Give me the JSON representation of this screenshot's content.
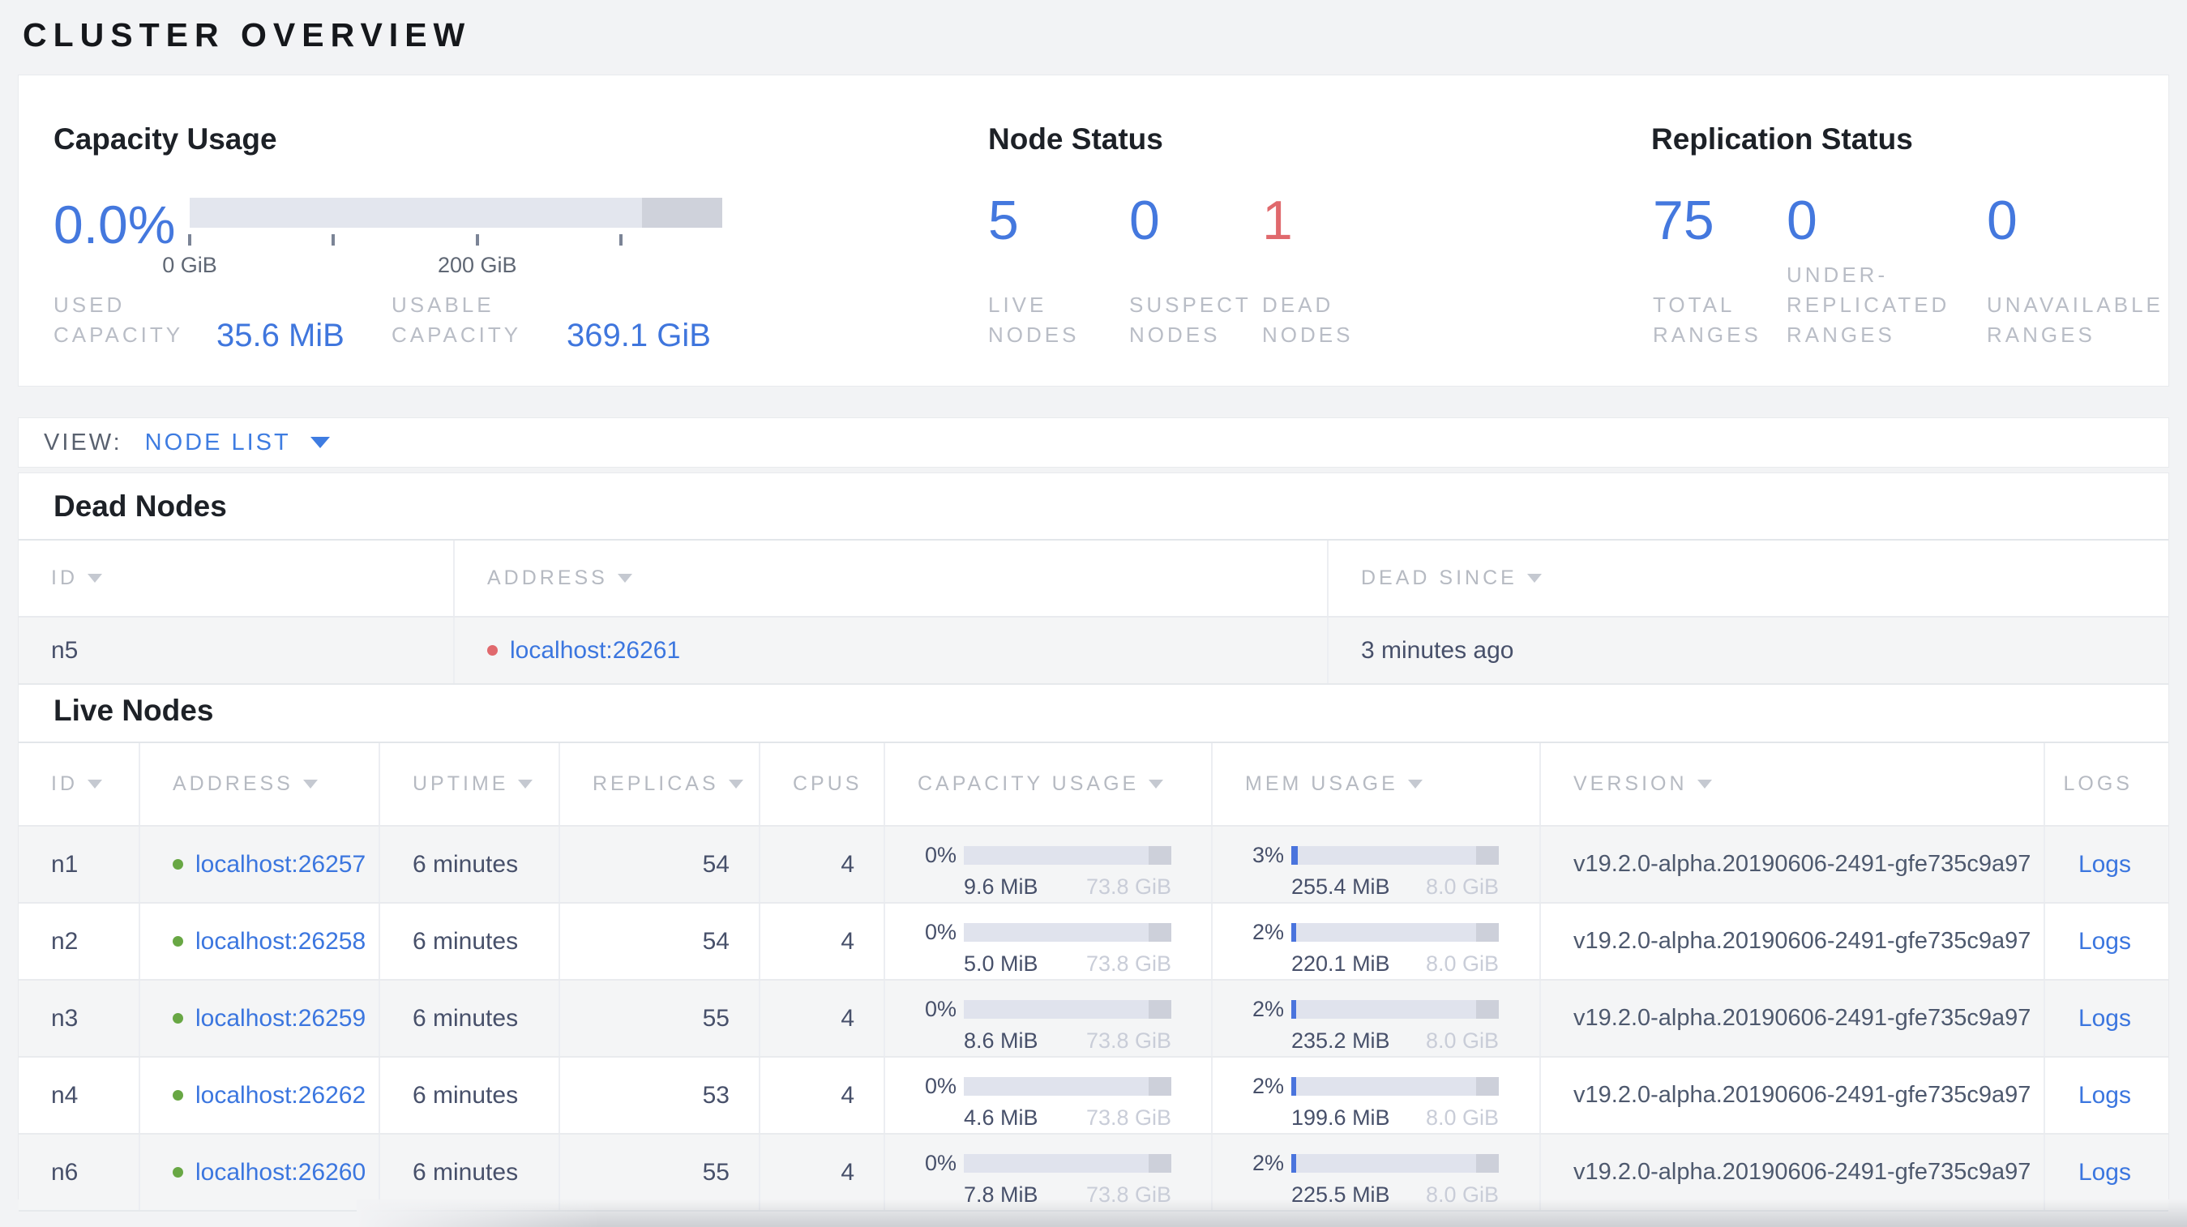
{
  "page_title": "CLUSTER OVERVIEW",
  "summary": {
    "capacity": {
      "title": "Capacity Usage",
      "percent": "0.0%",
      "bar": {
        "fill_pct": 0,
        "tick_label_0": "0 GiB",
        "tick_label_200": "200 GiB"
      },
      "stats": [
        {
          "label": "USED CAPACITY",
          "value": "35.6 MiB"
        },
        {
          "label": "USABLE CAPACITY",
          "value": "369.1 GiB"
        }
      ]
    },
    "node_status": {
      "title": "Node Status",
      "stats": [
        {
          "value": "5",
          "label": "LIVE NODES"
        },
        {
          "value": "0",
          "label": "SUSPECT NODES"
        },
        {
          "value": "1",
          "label": "DEAD NODES"
        }
      ]
    },
    "replication": {
      "title": "Replication Status",
      "stats": [
        {
          "value": "75",
          "label": "TOTAL RANGES"
        },
        {
          "value": "0",
          "label": "UNDER-REPLICATED RANGES"
        },
        {
          "value": "0",
          "label": "UNAVAILABLE RANGES"
        }
      ]
    }
  },
  "view_bar": {
    "label": "VIEW:",
    "selected": "NODE LIST"
  },
  "dead_nodes": {
    "title": "Dead Nodes",
    "columns": [
      {
        "label": "ID",
        "sortable": true
      },
      {
        "label": "ADDRESS",
        "sortable": true
      },
      {
        "label": "DEAD SINCE",
        "sortable": true
      }
    ],
    "rows": [
      {
        "id": "n5",
        "address": "localhost:26261",
        "dead_since": "3 minutes ago"
      }
    ]
  },
  "live_nodes": {
    "title": "Live Nodes",
    "columns": [
      {
        "label": "ID",
        "sortable": true
      },
      {
        "label": "ADDRESS",
        "sortable": true
      },
      {
        "label": "UPTIME",
        "sortable": true
      },
      {
        "label": "REPLICAS",
        "sortable": true
      },
      {
        "label": "CPUS",
        "sortable": false
      },
      {
        "label": "CAPACITY USAGE",
        "sortable": true
      },
      {
        "label": "MEM USAGE",
        "sortable": true
      },
      {
        "label": "VERSION",
        "sortable": true
      },
      {
        "label": "LOGS",
        "sortable": false
      }
    ],
    "rows": [
      {
        "id": "n1",
        "address": "localhost:26257",
        "uptime": "6 minutes",
        "replicas": "54",
        "cpus": "4",
        "capacity": {
          "percent": "0%",
          "used": "9.6 MiB",
          "capacity": "73.8 GiB",
          "fill_pct": 0
        },
        "memory": {
          "percent": "3%",
          "used": "255.4 MiB",
          "capacity": "8.0 GiB",
          "fill_pct": 3
        },
        "version": "v19.2.0-alpha.20190606-2491-gfe735c9a97",
        "logs_label": "Logs"
      },
      {
        "id": "n2",
        "address": "localhost:26258",
        "uptime": "6 minutes",
        "replicas": "54",
        "cpus": "4",
        "capacity": {
          "percent": "0%",
          "used": "5.0 MiB",
          "capacity": "73.8 GiB",
          "fill_pct": 0
        },
        "memory": {
          "percent": "2%",
          "used": "220.1 MiB",
          "capacity": "8.0 GiB",
          "fill_pct": 2.5
        },
        "version": "v19.2.0-alpha.20190606-2491-gfe735c9a97",
        "logs_label": "Logs"
      },
      {
        "id": "n3",
        "address": "localhost:26259",
        "uptime": "6 minutes",
        "replicas": "55",
        "cpus": "4",
        "capacity": {
          "percent": "0%",
          "used": "8.6 MiB",
          "capacity": "73.8 GiB",
          "fill_pct": 0
        },
        "memory": {
          "percent": "2%",
          "used": "235.2 MiB",
          "capacity": "8.0 GiB",
          "fill_pct": 2.5
        },
        "version": "v19.2.0-alpha.20190606-2491-gfe735c9a97",
        "logs_label": "Logs"
      },
      {
        "id": "n4",
        "address": "localhost:26262",
        "uptime": "6 minutes",
        "replicas": "53",
        "cpus": "4",
        "capacity": {
          "percent": "0%",
          "used": "4.6 MiB",
          "capacity": "73.8 GiB",
          "fill_pct": 0
        },
        "memory": {
          "percent": "2%",
          "used": "199.6 MiB",
          "capacity": "8.0 GiB",
          "fill_pct": 2.5
        },
        "version": "v19.2.0-alpha.20190606-2491-gfe735c9a97",
        "logs_label": "Logs"
      },
      {
        "id": "n6",
        "address": "localhost:26260",
        "uptime": "6 minutes",
        "replicas": "55",
        "cpus": "4",
        "capacity": {
          "percent": "0%",
          "used": "7.8 MiB",
          "capacity": "73.8 GiB",
          "fill_pct": 0
        },
        "memory": {
          "percent": "2%",
          "used": "225.5 MiB",
          "capacity": "8.0 GiB",
          "fill_pct": 2.5
        },
        "version": "v19.2.0-alpha.20190606-2491-gfe735c9a97",
        "logs_label": "Logs"
      }
    ]
  },
  "colors": {
    "accent_blue": "#3e76dd",
    "dead_red": "#e0696d",
    "live_green": "#68a744",
    "bar_track": "#e0e3ed",
    "bar_reserved": "#cdd0da"
  }
}
